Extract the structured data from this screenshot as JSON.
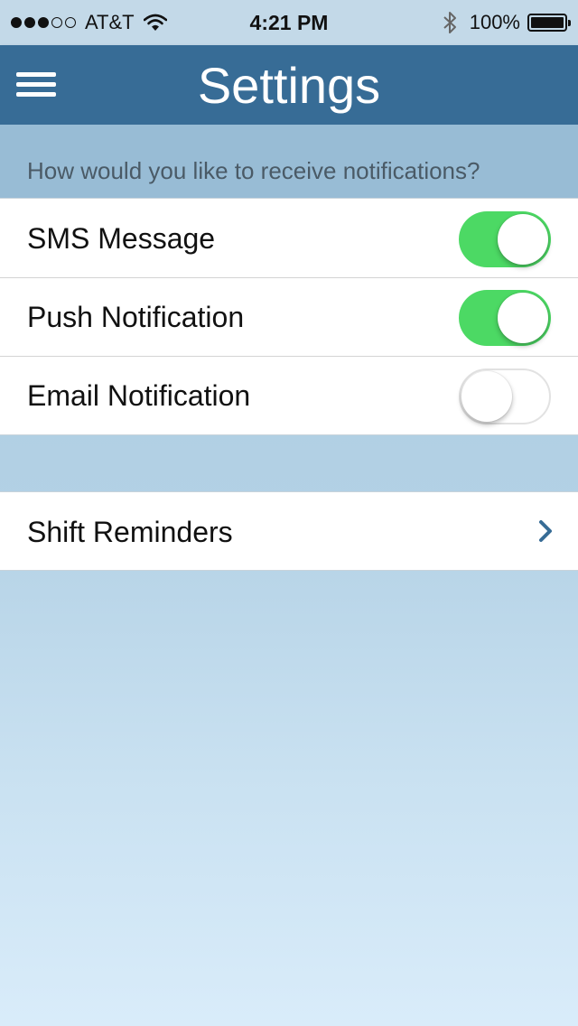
{
  "status_bar": {
    "carrier": "AT&T",
    "signal_bars_filled": 3,
    "signal_bars_total": 5,
    "time": "4:21 PM",
    "battery": "100%",
    "icons": [
      "wifi-icon",
      "bluetooth-icon",
      "battery-icon"
    ]
  },
  "nav": {
    "title": "Settings",
    "menu_icon": "hamburger-menu-icon"
  },
  "notifications": {
    "prompt": "How would you like to receive notifications?",
    "options": [
      {
        "label": "SMS Message",
        "enabled": true
      },
      {
        "label": "Push Notification",
        "enabled": true
      },
      {
        "label": "Email Notification",
        "enabled": false
      }
    ]
  },
  "links": {
    "shift_reminders": "Shift Reminders",
    "chevron_icon": "chevron-right-icon"
  },
  "colors": {
    "nav_bar": "#376c96",
    "toggle_on": "#4cd964",
    "chevron": "#376c96"
  }
}
